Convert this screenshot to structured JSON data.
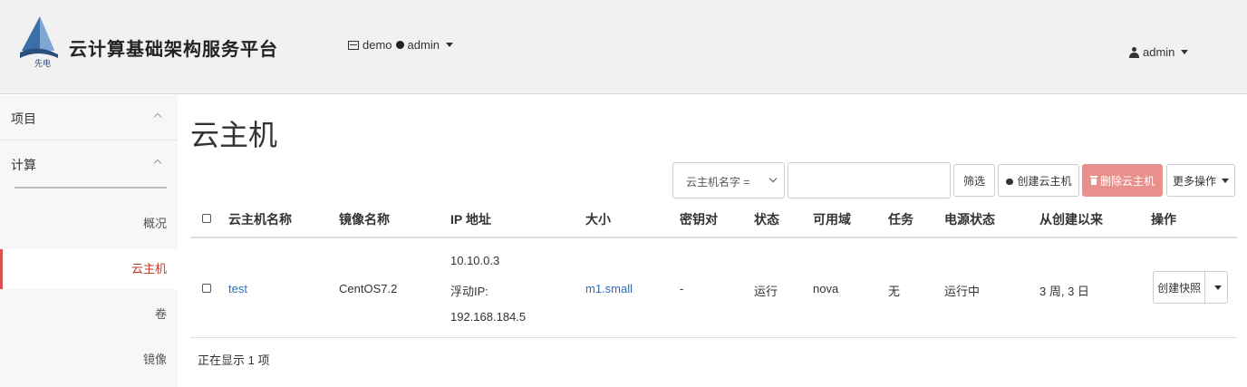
{
  "header": {
    "brand": "云计算基础架构服务平台",
    "context_project": "demo",
    "context_user": "admin",
    "user_menu": "admin",
    "logo_text": "先电"
  },
  "sidebar": {
    "sections": [
      {
        "label": "项目"
      },
      {
        "label": "计算"
      }
    ],
    "items": [
      {
        "label": "概况"
      },
      {
        "label": "云主机"
      },
      {
        "label": "卷"
      },
      {
        "label": "镜像"
      }
    ]
  },
  "main": {
    "title": "云主机",
    "filter_select": "云主机名字 =",
    "filter_value": "",
    "buttons": {
      "filter": "筛选",
      "create": "创建云主机",
      "delete": "删除云主机",
      "more": "更多操作"
    },
    "table": {
      "columns": [
        "云主机名称",
        "镜像名称",
        "IP 地址",
        "大小",
        "密钥对",
        "状态",
        "可用域",
        "任务",
        "电源状态",
        "从创建以来",
        "操作"
      ],
      "rows": [
        {
          "name": "test",
          "image": "CentOS7.2",
          "ip_fixed": "10.10.0.3",
          "ip_float_label": "浮动IP:",
          "ip_float": "192.168.184.5",
          "size": "m1.small",
          "keypair": "-",
          "status": "运行",
          "zone": "nova",
          "task": "无",
          "power": "运行中",
          "age": "3 周, 3 日",
          "action": "创建快照"
        }
      ]
    },
    "footer": "正在显示 1 项"
  },
  "colors": {
    "delete_button": "#e8908c",
    "active_nav": "#d9534f",
    "link": "#2a6ebb"
  }
}
